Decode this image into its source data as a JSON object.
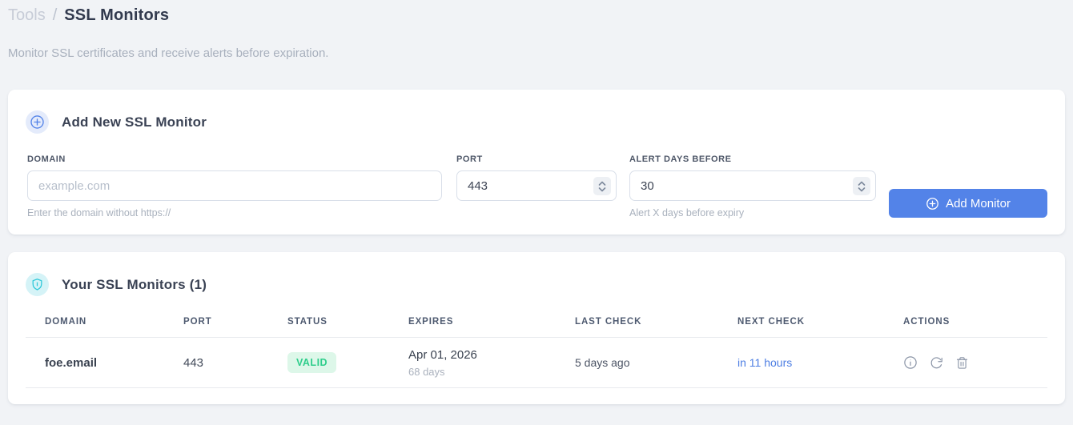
{
  "breadcrumb": {
    "section": "Tools",
    "separator": "/",
    "current": "SSL Monitors"
  },
  "subtitle": "Monitor SSL certificates and receive alerts before expiration.",
  "add_form": {
    "title": "Add New SSL Monitor",
    "fields": {
      "domain": {
        "label": "DOMAIN",
        "placeholder": "example.com",
        "help": "Enter the domain without https://"
      },
      "port": {
        "label": "PORT",
        "value": "443"
      },
      "alert_days": {
        "label": "ALERT DAYS BEFORE",
        "value": "30",
        "help": "Alert X days before expiry"
      }
    },
    "submit_label": "Add Monitor"
  },
  "monitors": {
    "title": "Your SSL Monitors (1)",
    "table": {
      "headers": [
        "DOMAIN",
        "PORT",
        "STATUS",
        "EXPIRES",
        "LAST CHECK",
        "NEXT CHECK",
        "ACTIONS"
      ],
      "rows": [
        {
          "domain": "foe.email",
          "port": "443",
          "status": "VALID",
          "expires_date": "Apr 01, 2026",
          "expires_days": "68 days",
          "last_check": "5 days ago",
          "next_check": "in 11 hours"
        }
      ]
    }
  },
  "icons": {
    "add_plus": "plus-circle-icon",
    "shield": "shield-icon",
    "row_info": "info-icon",
    "row_refresh": "refresh-icon",
    "row_delete": "trash-icon"
  },
  "colors": {
    "accent_blue": "#5383e8",
    "link_blue": "#4d7ee3",
    "valid_bg": "#ddf7e9",
    "valid_text": "#2fce8c",
    "cyan": "#2fc8d9",
    "page_bg": "#f1f3f6"
  }
}
